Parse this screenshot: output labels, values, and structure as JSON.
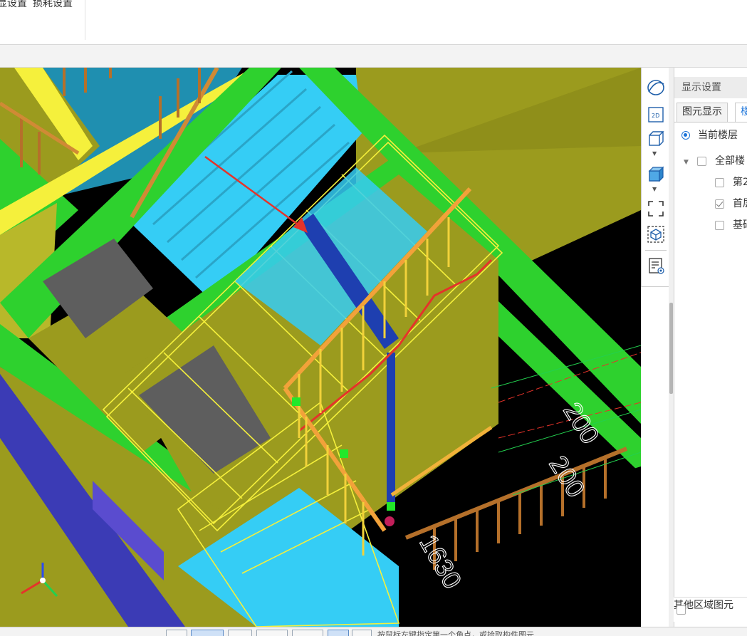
{
  "ribbon": {
    "item_display": "显设置",
    "item_loss": "损耗设置"
  },
  "viewport": {
    "dimension_labels": [
      "200",
      "200",
      "1630"
    ],
    "colors": {
      "background": "#000000",
      "slab": "#9b9b1e",
      "beam": "#2ed12e",
      "stair": "#35cdf5",
      "railing": "#f2d23a",
      "baluster": "#b5702a",
      "arrow": "#e5332a",
      "column": "#1e3fb0"
    }
  },
  "view_toolbar": {
    "buttons": [
      "orbit-icon",
      "view-2d-icon",
      "cube-wireframe-icon",
      "cube-solid-icon",
      "fit-view-icon",
      "locate-3d-icon",
      "display-list-icon"
    ],
    "label_2d": "2D"
  },
  "panel": {
    "title": "显示设置",
    "tabs": [
      "图元显示",
      "楼"
    ],
    "radio_current_floor": "当前楼层",
    "tree": {
      "all_floors": "全部楼",
      "floors": [
        {
          "label": "第2",
          "checked": false
        },
        {
          "label": "首层",
          "checked": true
        },
        {
          "label": "基础",
          "checked": false
        }
      ]
    },
    "other_area": "其他区域图元"
  },
  "status_bar": {
    "text": "按鼠标左键指定第一个角点，或拾取构件图元"
  }
}
